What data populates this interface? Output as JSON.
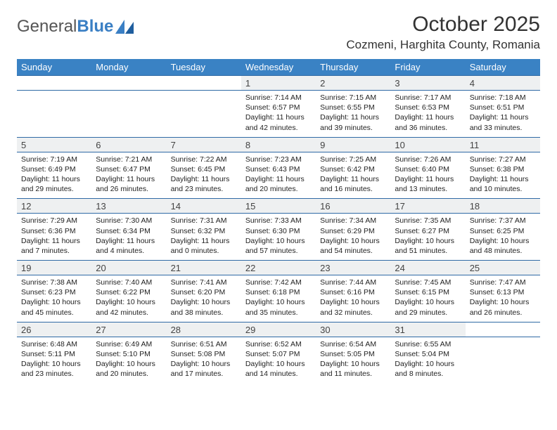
{
  "brand": {
    "part1": "General",
    "part2": "Blue"
  },
  "title": "October 2025",
  "location": "Cozmeni, Harghita County, Romania",
  "weekdays": [
    "Sunday",
    "Monday",
    "Tuesday",
    "Wednesday",
    "Thursday",
    "Friday",
    "Saturday"
  ],
  "weeks": [
    [
      null,
      null,
      null,
      {
        "n": "1",
        "sr": "7:14 AM",
        "ss": "6:57 PM",
        "dl": "11 hours and 42 minutes."
      },
      {
        "n": "2",
        "sr": "7:15 AM",
        "ss": "6:55 PM",
        "dl": "11 hours and 39 minutes."
      },
      {
        "n": "3",
        "sr": "7:17 AM",
        "ss": "6:53 PM",
        "dl": "11 hours and 36 minutes."
      },
      {
        "n": "4",
        "sr": "7:18 AM",
        "ss": "6:51 PM",
        "dl": "11 hours and 33 minutes."
      }
    ],
    [
      {
        "n": "5",
        "sr": "7:19 AM",
        "ss": "6:49 PM",
        "dl": "11 hours and 29 minutes."
      },
      {
        "n": "6",
        "sr": "7:21 AM",
        "ss": "6:47 PM",
        "dl": "11 hours and 26 minutes."
      },
      {
        "n": "7",
        "sr": "7:22 AM",
        "ss": "6:45 PM",
        "dl": "11 hours and 23 minutes."
      },
      {
        "n": "8",
        "sr": "7:23 AM",
        "ss": "6:43 PM",
        "dl": "11 hours and 20 minutes."
      },
      {
        "n": "9",
        "sr": "7:25 AM",
        "ss": "6:42 PM",
        "dl": "11 hours and 16 minutes."
      },
      {
        "n": "10",
        "sr": "7:26 AM",
        "ss": "6:40 PM",
        "dl": "11 hours and 13 minutes."
      },
      {
        "n": "11",
        "sr": "7:27 AM",
        "ss": "6:38 PM",
        "dl": "11 hours and 10 minutes."
      }
    ],
    [
      {
        "n": "12",
        "sr": "7:29 AM",
        "ss": "6:36 PM",
        "dl": "11 hours and 7 minutes."
      },
      {
        "n": "13",
        "sr": "7:30 AM",
        "ss": "6:34 PM",
        "dl": "11 hours and 4 minutes."
      },
      {
        "n": "14",
        "sr": "7:31 AM",
        "ss": "6:32 PM",
        "dl": "11 hours and 0 minutes."
      },
      {
        "n": "15",
        "sr": "7:33 AM",
        "ss": "6:30 PM",
        "dl": "10 hours and 57 minutes."
      },
      {
        "n": "16",
        "sr": "7:34 AM",
        "ss": "6:29 PM",
        "dl": "10 hours and 54 minutes."
      },
      {
        "n": "17",
        "sr": "7:35 AM",
        "ss": "6:27 PM",
        "dl": "10 hours and 51 minutes."
      },
      {
        "n": "18",
        "sr": "7:37 AM",
        "ss": "6:25 PM",
        "dl": "10 hours and 48 minutes."
      }
    ],
    [
      {
        "n": "19",
        "sr": "7:38 AM",
        "ss": "6:23 PM",
        "dl": "10 hours and 45 minutes."
      },
      {
        "n": "20",
        "sr": "7:40 AM",
        "ss": "6:22 PM",
        "dl": "10 hours and 42 minutes."
      },
      {
        "n": "21",
        "sr": "7:41 AM",
        "ss": "6:20 PM",
        "dl": "10 hours and 38 minutes."
      },
      {
        "n": "22",
        "sr": "7:42 AM",
        "ss": "6:18 PM",
        "dl": "10 hours and 35 minutes."
      },
      {
        "n": "23",
        "sr": "7:44 AM",
        "ss": "6:16 PM",
        "dl": "10 hours and 32 minutes."
      },
      {
        "n": "24",
        "sr": "7:45 AM",
        "ss": "6:15 PM",
        "dl": "10 hours and 29 minutes."
      },
      {
        "n": "25",
        "sr": "7:47 AM",
        "ss": "6:13 PM",
        "dl": "10 hours and 26 minutes."
      }
    ],
    [
      {
        "n": "26",
        "sr": "6:48 AM",
        "ss": "5:11 PM",
        "dl": "10 hours and 23 minutes."
      },
      {
        "n": "27",
        "sr": "6:49 AM",
        "ss": "5:10 PM",
        "dl": "10 hours and 20 minutes."
      },
      {
        "n": "28",
        "sr": "6:51 AM",
        "ss": "5:08 PM",
        "dl": "10 hours and 17 minutes."
      },
      {
        "n": "29",
        "sr": "6:52 AM",
        "ss": "5:07 PM",
        "dl": "10 hours and 14 minutes."
      },
      {
        "n": "30",
        "sr": "6:54 AM",
        "ss": "5:05 PM",
        "dl": "10 hours and 11 minutes."
      },
      {
        "n": "31",
        "sr": "6:55 AM",
        "ss": "5:04 PM",
        "dl": "10 hours and 8 minutes."
      },
      null
    ]
  ],
  "labels": {
    "sunrise": "Sunrise: ",
    "sunset": "Sunset: ",
    "daylight": "Daylight: "
  }
}
